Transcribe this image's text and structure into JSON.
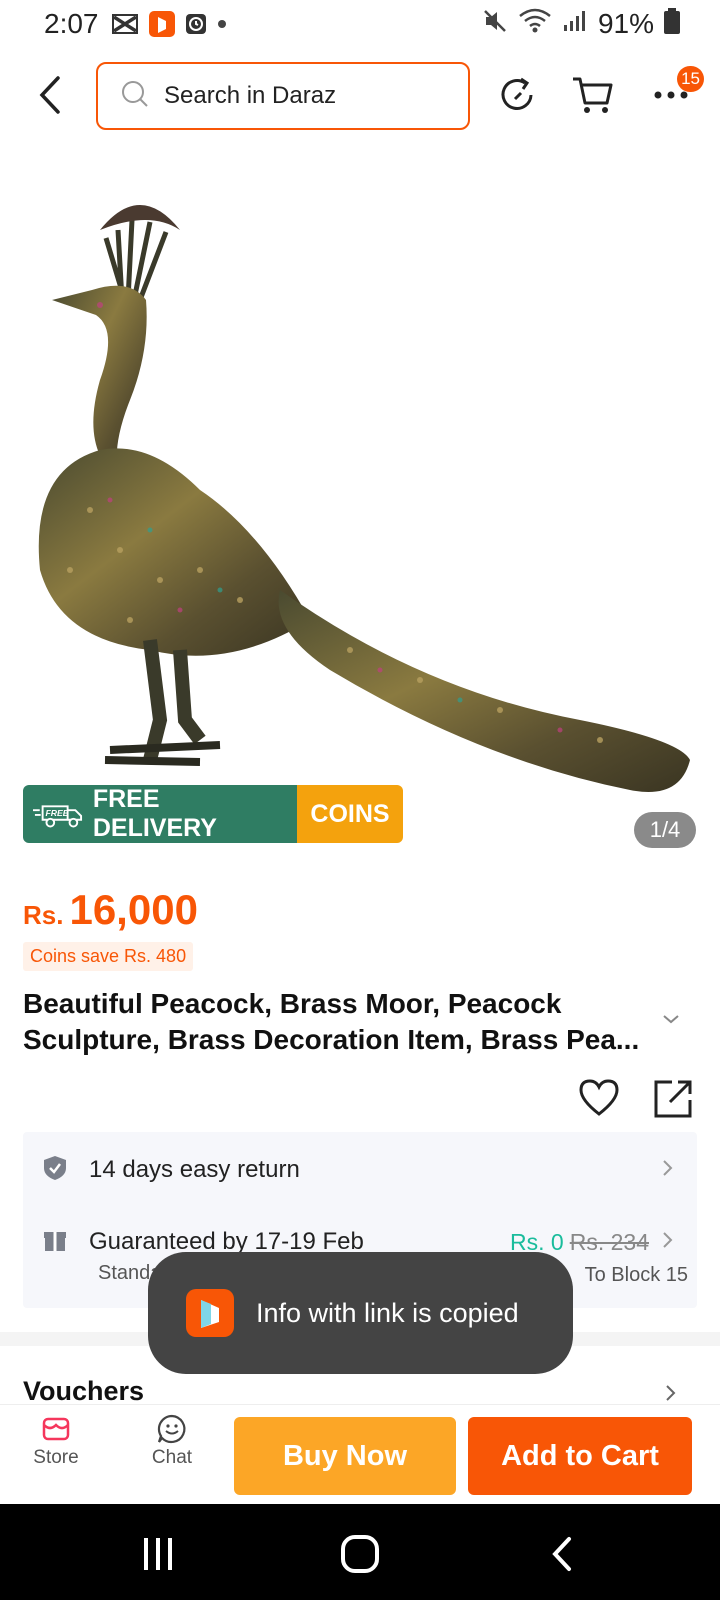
{
  "status_bar": {
    "time": "2:07",
    "battery": "91%"
  },
  "header": {
    "search_placeholder": "Search in Daraz",
    "menu_badge": "15"
  },
  "product": {
    "image_counter": "1/4",
    "banner_free_delivery": "FREE DELIVERY",
    "banner_free_tag": "FREE",
    "banner_coins": "COINS",
    "currency": "Rs.",
    "price": "16,000",
    "coins_save": "Coins save Rs. 480",
    "title": "Beautiful Peacock, Brass Moor, Peacock Sculpture, Brass Decoration Item, Brass Pea..."
  },
  "service": {
    "return_text": "14 days easy return",
    "delivery_text": "Guaranteed by 17-19 Feb",
    "delivery_sub": "Standard Delivery",
    "delivery_price": "Rs. 0",
    "delivery_old_price": "Rs. 234",
    "delivery_location": "To Block 15"
  },
  "vouchers": {
    "label": "Vouchers"
  },
  "toast": {
    "message": "Info with link is copied"
  },
  "bottom_bar": {
    "store_label": "Store",
    "chat_label": "Chat",
    "buy_now_label": "Buy Now",
    "add_to_cart_label": "Add to Cart"
  },
  "colors": {
    "accent": "#f85606",
    "buy_now": "#fca626",
    "free_delivery_green": "#2f7d63",
    "coins_yellow": "#f4a20d",
    "free_shipping_teal": "#1abc9c"
  }
}
